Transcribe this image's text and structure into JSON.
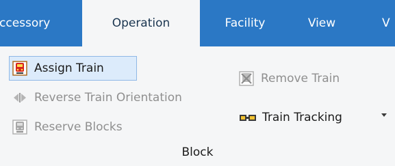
{
  "tabs": [
    {
      "label": "ccessory",
      "active": false
    },
    {
      "label": "Operation",
      "active": true
    },
    {
      "label": "Facility",
      "active": false
    },
    {
      "label": "View",
      "active": false
    },
    {
      "label": "V",
      "active": false
    }
  ],
  "commands": {
    "assign_train": "Assign Train",
    "reverse_orientation": "Reverse Train Orientation",
    "reserve_blocks": "Reserve Blocks",
    "remove_train": "Remove Train",
    "train_tracking": "Train Tracking"
  },
  "group": {
    "label": "Block"
  },
  "icons": {
    "assign_train": "train-red-icon",
    "reverse_orientation": "reverse-arrows-icon",
    "reserve_blocks": "train-gray-icon",
    "remove_train": "remove-train-icon",
    "train_tracking": "train-tracking-icon",
    "dropdown": "chevron-down-icon"
  },
  "colors": {
    "tabbar_bg": "#2b78c5",
    "ribbon_bg": "#f5f6f7",
    "selected_bg": "#dcebfb",
    "disabled_text": "#8f8f8f"
  }
}
